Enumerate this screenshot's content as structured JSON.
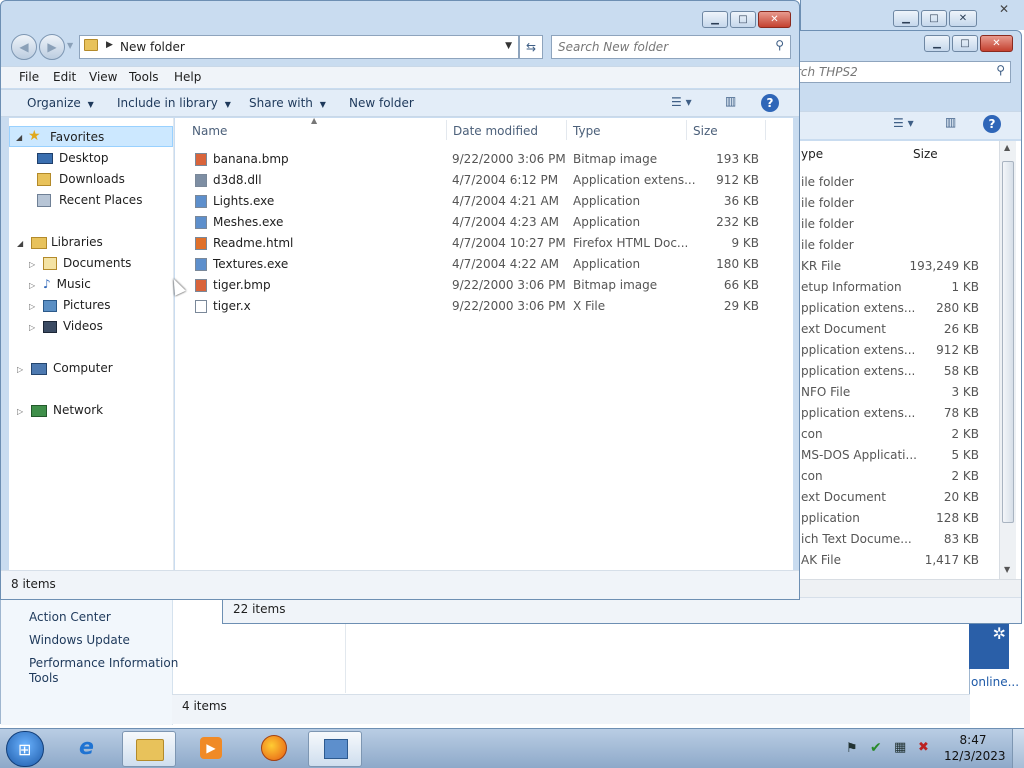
{
  "desktop_bg": "#ffffff",
  "control_panel": {
    "links": [
      "Action Center",
      "Windows Update",
      "Performance Information and",
      "Tools"
    ],
    "status": "4 items",
    "right_link": "online..."
  },
  "thps_window": {
    "search_placeholder": "rch THPS2",
    "col_type": "ype",
    "col_size": "Size",
    "rows": [
      {
        "type": "ile folder",
        "size": ""
      },
      {
        "type": "ile folder",
        "size": ""
      },
      {
        "type": "ile folder",
        "size": ""
      },
      {
        "type": "ile folder",
        "size": ""
      },
      {
        "type": "KR File",
        "size": "193,249 KB"
      },
      {
        "type": "etup Information",
        "size": "1 KB"
      },
      {
        "type": "pplication extens...",
        "size": "280 KB"
      },
      {
        "type": "ext Document",
        "size": "26 KB"
      },
      {
        "type": "pplication extens...",
        "size": "912 KB"
      },
      {
        "type": "pplication extens...",
        "size": "58 KB"
      },
      {
        "type": "NFO File",
        "size": "3 KB"
      },
      {
        "type": "pplication extens...",
        "size": "78 KB"
      },
      {
        "type": "con",
        "size": "2 KB"
      },
      {
        "type": "MS-DOS Applicati...",
        "size": "5 KB"
      },
      {
        "type": "con",
        "size": "2 KB"
      },
      {
        "type": "ext Document",
        "size": "20 KB"
      },
      {
        "type": "pplication",
        "size": "128 KB"
      },
      {
        "type": "ich Text Docume...",
        "size": "83 KB"
      },
      {
        "type": "AK File",
        "size": "1,417 KB"
      }
    ],
    "status": "22 items"
  },
  "explorer": {
    "address": "New folder",
    "search_placeholder": "Search New folder",
    "menu": [
      "File",
      "Edit",
      "View",
      "Tools",
      "Help"
    ],
    "toolbar": {
      "organize": "Organize",
      "include": "Include in library",
      "share": "Share with",
      "new_folder": "New folder"
    },
    "columns": {
      "name": "Name",
      "date": "Date modified",
      "type": "Type",
      "size": "Size"
    },
    "files": [
      {
        "name": "banana.bmp",
        "date": "9/22/2000 3:06 PM",
        "type": "Bitmap image",
        "size": "193 KB",
        "icon": "bitmap-icon"
      },
      {
        "name": "d3d8.dll",
        "date": "4/7/2004 6:12 PM",
        "type": "Application extens...",
        "size": "912 KB",
        "icon": "dll-icon"
      },
      {
        "name": "Lights.exe",
        "date": "4/7/2004 4:21 AM",
        "type": "Application",
        "size": "36 KB",
        "icon": "exe-icon"
      },
      {
        "name": "Meshes.exe",
        "date": "4/7/2004 4:23 AM",
        "type": "Application",
        "size": "232 KB",
        "icon": "exe-icon"
      },
      {
        "name": "Readme.html",
        "date": "4/7/2004 10:27 PM",
        "type": "Firefox HTML Doc...",
        "size": "9 KB",
        "icon": "html-icon"
      },
      {
        "name": "Textures.exe",
        "date": "4/7/2004 4:22 AM",
        "type": "Application",
        "size": "180 KB",
        "icon": "exe-icon"
      },
      {
        "name": "tiger.bmp",
        "date": "9/22/2000 3:06 PM",
        "type": "Bitmap image",
        "size": "66 KB",
        "icon": "bitmap-icon"
      },
      {
        "name": "tiger.x",
        "date": "9/22/2000 3:06 PM",
        "type": "X File",
        "size": "29 KB",
        "icon": "file-icon"
      }
    ],
    "nav": {
      "favorites": "Favorites",
      "desktop": "Desktop",
      "downloads": "Downloads",
      "recent": "Recent Places",
      "libraries": "Libraries",
      "documents": "Documents",
      "music": "Music",
      "pictures": "Pictures",
      "videos": "Videos",
      "computer": "Computer",
      "network": "Network"
    },
    "status": "8 items"
  },
  "taskbar": {
    "time": "8:47",
    "date": "12/3/2023"
  },
  "colors": {
    "chrome": "#c9dcf0",
    "toolbar": "#e3edf8",
    "selection": "#cce8ff",
    "close": "#c4412f",
    "taskbar": "#9ab4d2"
  }
}
